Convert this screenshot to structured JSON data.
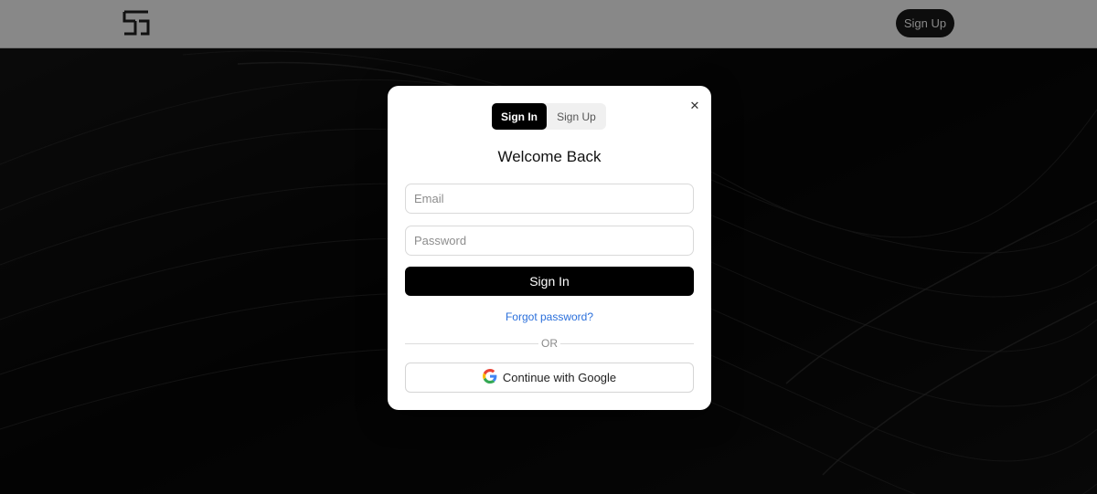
{
  "header": {
    "logo_icon": "app-logo-icon",
    "signup_label": "Sign Up"
  },
  "modal": {
    "close_icon": "close-icon",
    "tabs": [
      {
        "label": "Sign In",
        "active": true
      },
      {
        "label": "Sign Up",
        "active": false
      }
    ],
    "title": "Welcome Back",
    "email": {
      "placeholder": "Email",
      "value": ""
    },
    "password": {
      "placeholder": "Password",
      "value": ""
    },
    "submit_label": "Sign In",
    "forgot_label": "Forgot password?",
    "divider_label": "OR",
    "google_icon": "google-icon",
    "google_label": "Continue with Google"
  },
  "colors": {
    "primary": "#000000",
    "link": "#2a6fdb",
    "header_bg": "#888888"
  }
}
